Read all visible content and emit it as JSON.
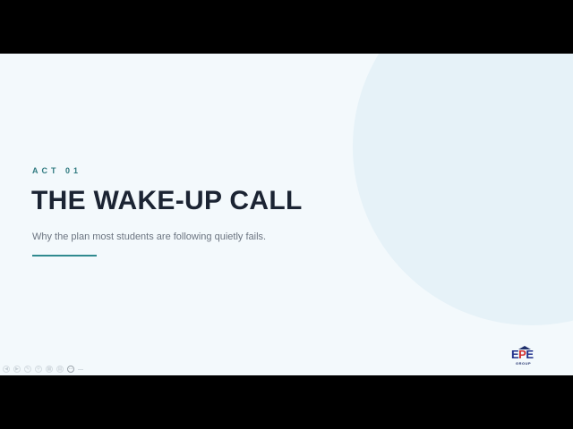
{
  "slide": {
    "eyebrow": "ACT 01",
    "title": "THE WAKE-UP CALL",
    "subtitle": "Why the plan most students are following quietly fails."
  },
  "logo": {
    "letters": [
      "E",
      "P",
      "E"
    ],
    "sub": "GROUP"
  },
  "controls": {
    "icons": [
      "prev-icon",
      "next-icon",
      "pen-icon",
      "zoom-icon",
      "grid-icon",
      "more-icon"
    ]
  },
  "colors": {
    "slide_bg": "#f3f9fc",
    "circle": "#e6f2f8",
    "title": "#1b2433",
    "eyebrow": "#2f7a80",
    "accent": "#2f8a8f",
    "logo_blue": "#1f2f8b",
    "logo_red": "#d22c2c"
  }
}
